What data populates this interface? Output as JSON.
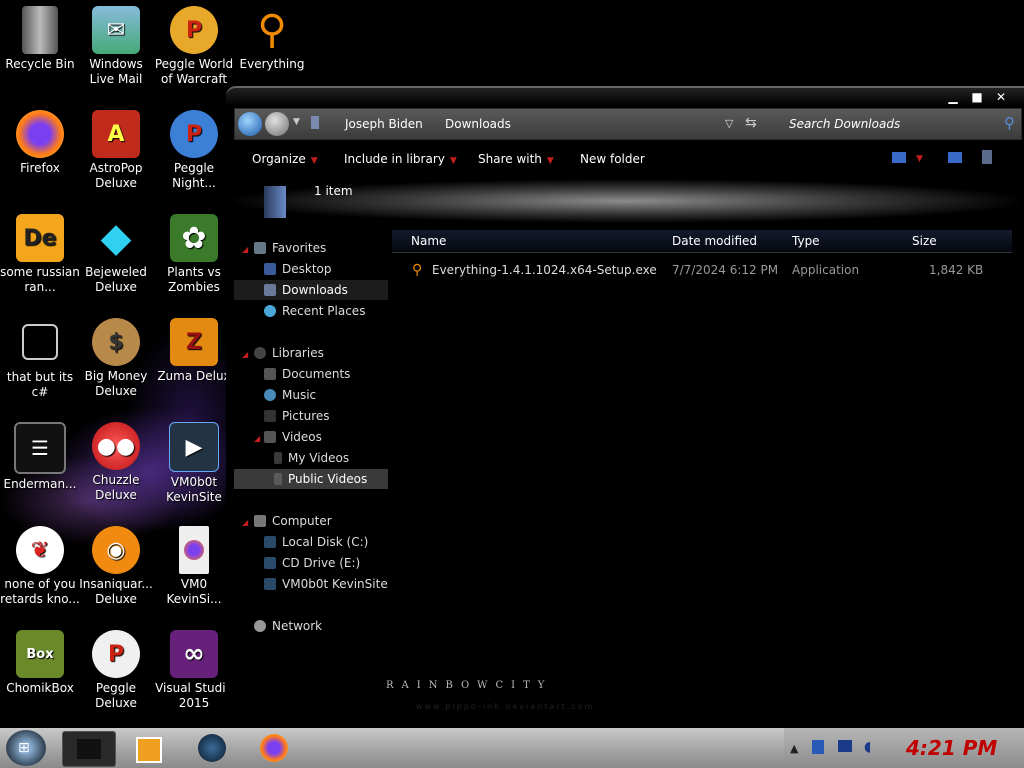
{
  "desktop": {
    "icons": [
      {
        "label": "Recycle Bin",
        "icon": "recycle-bin-icon"
      },
      {
        "label": "Windows Live Mail",
        "icon": "mail-icon"
      },
      {
        "label": "Peggle World of Warcraft",
        "icon": "peggle-icon"
      },
      {
        "label": "Everything",
        "icon": "magnifier-icon"
      },
      {
        "label": "Firefox",
        "icon": "firefox-icon"
      },
      {
        "label": "AstroPop Deluxe",
        "icon": "astropop-icon"
      },
      {
        "label": "Peggle Night...",
        "icon": "peggle-icon"
      },
      {
        "label": "some russian ran...",
        "icon": "de-icon"
      },
      {
        "label": "Bejeweled Deluxe",
        "icon": "diamond-icon"
      },
      {
        "label": "Plants vs Zombies",
        "icon": "flower-icon"
      },
      {
        "label": "that but its c#",
        "icon": "windows-stack-icon"
      },
      {
        "label": "Big Money Deluxe",
        "icon": "money-bag-icon"
      },
      {
        "label": "Zuma Delux",
        "icon": "zuma-icon"
      },
      {
        "label": "Enderman...",
        "icon": "console-icon"
      },
      {
        "label": "Chuzzle Deluxe",
        "icon": "chuzzle-icon"
      },
      {
        "label": "VM0b0t KevinSite",
        "icon": "video-icon"
      },
      {
        "label": "none of you retards kno...",
        "icon": "dragon-icon"
      },
      {
        "label": "Insaniquar... Deluxe",
        "icon": "fish-icon"
      },
      {
        "label": "VM0 KevinSi...",
        "icon": "firefox-file-icon"
      },
      {
        "label": "ChomikBox",
        "icon": "chomikbox-icon"
      },
      {
        "label": "Peggle Deluxe",
        "icon": "peggle-icon"
      },
      {
        "label": "Visual Studio 2015",
        "icon": "visual-studio-icon"
      }
    ]
  },
  "explorer": {
    "window_controls": {
      "minimize": "▁",
      "maximize": "■",
      "close": "✕"
    },
    "breadcrumb": [
      "Joseph Biden",
      "Downloads"
    ],
    "search_placeholder": "Search Downloads",
    "toolbar": {
      "organize": "Organize",
      "include_in_library": "Include in library",
      "share_with": "Share with",
      "new_folder": "New folder"
    },
    "item_count": "1 item",
    "nav": {
      "favorites": "Favorites",
      "desktop": "Desktop",
      "downloads": "Downloads",
      "recent_places": "Recent Places",
      "libraries": "Libraries",
      "documents": "Documents",
      "music": "Music",
      "pictures": "Pictures",
      "videos": "Videos",
      "my_videos": "My Videos",
      "public_videos": "Public Videos",
      "computer": "Computer",
      "local_disk": "Local Disk (C:)",
      "cd_drive": "CD Drive (E:)",
      "vm0b0t": "VM0b0t KevinSite",
      "network": "Network"
    },
    "columns": {
      "name": "Name",
      "date_modified": "Date modified",
      "type": "Type",
      "size": "Size"
    },
    "files": [
      {
        "name": "Everything-1.4.1.1024.x64-Setup.exe",
        "date": "7/7/2024 6:12 PM",
        "type": "Application",
        "size": "1,842 KB"
      }
    ],
    "brand": "RAINBOWCITY",
    "brand_url": "www.pippo-ink.deviantart.com"
  },
  "taskbar": {
    "clock": "4:21 PM",
    "accent": "#c00000"
  }
}
